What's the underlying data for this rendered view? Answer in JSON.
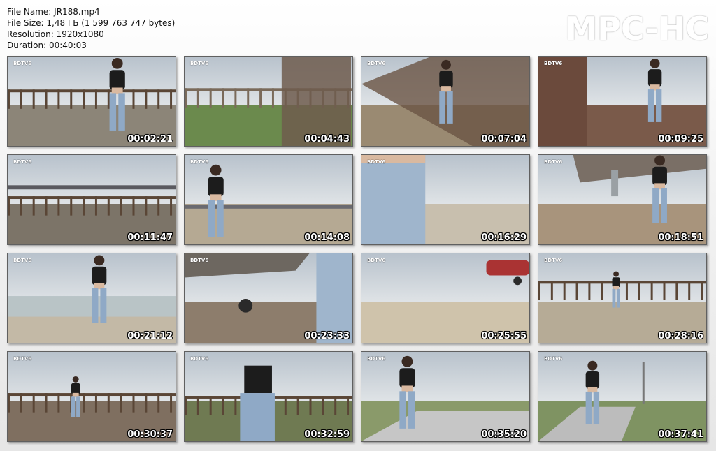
{
  "info": {
    "file_name": "File Name: JR188.mp4",
    "file_size": "File Size: 1,48 ГБ (1 599 763 747 bytes)",
    "resolution": "Resolution: 1920x1080",
    "duration": "Duration: 00:40:03"
  },
  "brand": "MPC-HC",
  "thumbnails": [
    {
      "time": "00:02:21",
      "logo": "BDTV6",
      "scene": "boardwalk-woman-back",
      "ground": "#8c8578"
    },
    {
      "time": "00:04:43",
      "logo": "BDTV6",
      "scene": "railing-lawn",
      "ground": "#6b8a4d"
    },
    {
      "time": "00:07:04",
      "logo": "BDTV6",
      "scene": "bridge-stairs",
      "ground": "#9a8a72"
    },
    {
      "time": "00:09:25",
      "logo": "BDTV6",
      "scene": "wet-path-lawn",
      "ground": "#7a5a4a"
    },
    {
      "time": "00:11:47",
      "logo": "BDTV6",
      "scene": "long-pier",
      "ground": "#7c7468"
    },
    {
      "time": "00:14:08",
      "logo": "BDTV6",
      "scene": "woman-beach-pier",
      "ground": "#b5a993"
    },
    {
      "time": "00:16:29",
      "logo": "BDTV6",
      "scene": "jeans-closeup-beach",
      "ground": "#c8bfae"
    },
    {
      "time": "00:18:51",
      "logo": "BDTV6",
      "scene": "under-bridge-walk",
      "ground": "#a8947c"
    },
    {
      "time": "00:21:12",
      "logo": "BDTV6",
      "scene": "woman-sea",
      "ground": "#c3b9a6"
    },
    {
      "time": "00:23:33",
      "logo": "BDTV6",
      "scene": "under-bridge-tire",
      "ground": "#8d7d6c"
    },
    {
      "time": "00:25:55",
      "logo": "BDTV6",
      "scene": "sand-boat",
      "ground": "#cfc3ab"
    },
    {
      "time": "00:28:16",
      "logo": "BDTV6",
      "scene": "beach-boardwalk-far",
      "ground": "#b6ab96"
    },
    {
      "time": "00:30:37",
      "logo": "BDTV6",
      "scene": "woman-fence-far",
      "ground": "#7f6f60"
    },
    {
      "time": "00:32:59",
      "logo": "BDTV6",
      "scene": "torso-fence",
      "ground": "#6f7a52"
    },
    {
      "time": "00:35:20",
      "logo": "BDTV6",
      "scene": "park-path",
      "ground": "#8a9a6a"
    },
    {
      "time": "00:37:41",
      "logo": "BDTV6",
      "scene": "park-lamp",
      "ground": "#7f9362"
    }
  ]
}
